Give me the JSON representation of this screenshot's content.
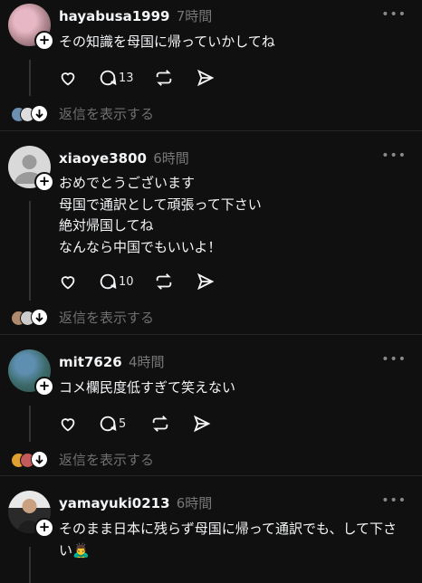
{
  "posts": [
    {
      "username": "hayabusa1999",
      "time": "7時間",
      "text": "その知識を母国に帰っていかしてね",
      "replies": "13",
      "more": "•••"
    },
    {
      "username": "xiaoye3800",
      "time": "6時間",
      "text": "おめでとうございます\n母国で通訳として頑張って下さい\n絶対帰国してね\nなんなら中国でもいいよ！",
      "replies": "10",
      "more": "•••"
    },
    {
      "username": "mit7626",
      "time": "4時間",
      "text": "コメ欄民度低すぎて笑えない",
      "replies": "5",
      "more": "•••"
    },
    {
      "username": "yamayuki0213",
      "time": "6時間",
      "text": "そのまま日本に残らず母国に帰って通訳でも、して下さい🙇‍♂️",
      "replies": "",
      "more": "•••"
    }
  ],
  "show_replies_label": "返信を表示する",
  "icons": {
    "like": "heart-icon",
    "reply": "comment-icon",
    "repost": "repost-icon",
    "share": "send-icon",
    "follow": "plus-icon",
    "expand": "chevron-down-icon"
  }
}
